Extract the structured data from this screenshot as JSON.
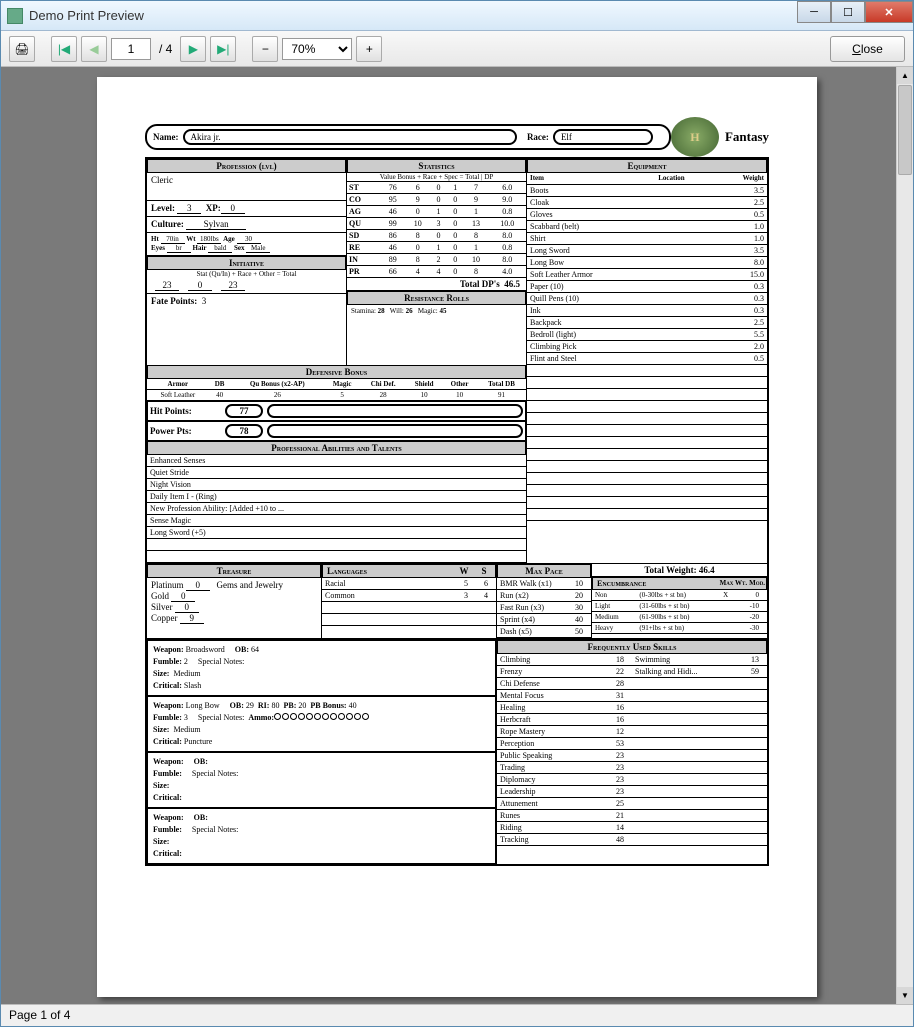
{
  "window": {
    "title": "Demo Print Preview"
  },
  "toolbar": {
    "page_current": "1",
    "page_total": "/ 4",
    "zoom": "70%",
    "close": "Close"
  },
  "status": "Page 1 of 4",
  "sheet": {
    "name_label": "Name:",
    "name": "Akira jr.",
    "race_label": "Race:",
    "race": "Elf",
    "fantasy": "Fantasy",
    "profession_label": "Profession (lvl)",
    "profession": "Cleric",
    "level_label": "Level:",
    "level": "3",
    "xp_label": "XP:",
    "xp": "0",
    "culture_label": "Culture:",
    "culture": "Sylvan",
    "ht_label": "Ht",
    "ht": "70in",
    "wt_label": "Wt",
    "wt": "180lbs",
    "age_label": "Age",
    "age": "30",
    "eyes_label": "Eyes",
    "eyes": "br",
    "hair_label": "Hair",
    "hair": "bald",
    "sex_label": "Sex",
    "sex": "Male",
    "initiative_label": "Initiative",
    "initiative_sub": "Stat (Qu/In) + Race + Other = Total",
    "init_stat": "23",
    "init_race": "0",
    "init_total": "23",
    "fate_label": "Fate Points:",
    "fate": "3",
    "stats_label": "Statistics",
    "stats_sub": "Value   Bonus + Race + Spec = Total | DP",
    "stats": [
      {
        "n": "ST",
        "v": "76",
        "b": "6",
        "r": "0",
        "s": "1",
        "t": "7",
        "dp": "6.0"
      },
      {
        "n": "CO",
        "v": "95",
        "b": "9",
        "r": "0",
        "s": "0",
        "t": "9",
        "dp": "9.0"
      },
      {
        "n": "AG",
        "v": "46",
        "b": "0",
        "r": "1",
        "s": "0",
        "t": "1",
        "dp": "0.8"
      },
      {
        "n": "QU",
        "v": "99",
        "b": "10",
        "r": "3",
        "s": "0",
        "t": "13",
        "dp": "10.0"
      },
      {
        "n": "SD",
        "v": "86",
        "b": "8",
        "r": "0",
        "s": "0",
        "t": "8",
        "dp": "8.0"
      },
      {
        "n": "RE",
        "v": "46",
        "b": "0",
        "r": "1",
        "s": "0",
        "t": "1",
        "dp": "0.8"
      },
      {
        "n": "IN",
        "v": "89",
        "b": "8",
        "r": "2",
        "s": "0",
        "t": "10",
        "dp": "8.0"
      },
      {
        "n": "PR",
        "v": "66",
        "b": "4",
        "r": "4",
        "s": "0",
        "t": "8",
        "dp": "4.0"
      }
    ],
    "total_dp_label": "Total DP's",
    "total_dp": "46.5",
    "rr_label": "Resistance Rolls",
    "rr_stamina_l": "Stamina:",
    "rr_stamina": "28",
    "rr_will_l": "Will:",
    "rr_will": "26",
    "rr_magic_l": "Magic:",
    "rr_magic": "45",
    "db_label": "Defensive Bonus",
    "db_hdr": [
      "Armor",
      "DB",
      "Qu Bonus (x2-AP)",
      "Magic",
      "Chi Def.",
      "Shield",
      "Other",
      "Total DB"
    ],
    "db_row": [
      "Soft Leather",
      "40",
      "26",
      "5",
      "28",
      "10",
      "10",
      "91"
    ],
    "hp_label": "Hit Points:",
    "hp": "77",
    "pp_label": "Power Pts:",
    "pp": "78",
    "abilities_label": "Professional Abilities and Talents",
    "abilities": [
      "Enhanced Senses",
      "Quiet Stride",
      "Night Vision",
      "Daily Item I - (Ring)",
      "New Profession Ability: [Added +10 to ...",
      "Sense Magic",
      "Long Sword (+5)"
    ],
    "equipment_label": "Equipment",
    "eq_hdr": [
      "Item",
      "Location",
      "Weight"
    ],
    "equipment": [
      {
        "n": "Boots",
        "w": "3.5"
      },
      {
        "n": "Cloak",
        "w": "2.5"
      },
      {
        "n": "Gloves",
        "w": "0.5"
      },
      {
        "n": "Scabbard (belt)",
        "w": "1.0"
      },
      {
        "n": "Shirt",
        "w": "1.0"
      },
      {
        "n": "Long Sword",
        "w": "3.5"
      },
      {
        "n": "Long Bow",
        "w": "8.0"
      },
      {
        "n": "Soft Leather Armor",
        "w": "15.0"
      },
      {
        "n": "Paper (10)",
        "w": "0.3"
      },
      {
        "n": "Quill Pens (10)",
        "w": "0.3"
      },
      {
        "n": "Ink",
        "w": "0.3"
      },
      {
        "n": "Backpack",
        "w": "2.5"
      },
      {
        "n": "Bedroll (light)",
        "w": "5.5"
      },
      {
        "n": "Climbing Pick",
        "w": "2.0"
      },
      {
        "n": "Flint and Steel",
        "w": "0.5"
      }
    ],
    "treasure_label": "Treasure",
    "treasure": [
      {
        "l": "Platinum",
        "v": "0"
      },
      {
        "l": "Gold",
        "v": "0"
      },
      {
        "l": "Silver",
        "v": "0"
      },
      {
        "l": "Copper",
        "v": "9"
      }
    ],
    "gems_label": "Gems and Jewelry",
    "lang_label": "Languages",
    "lang_hdr_w": "W",
    "lang_hdr_s": "S",
    "languages": [
      {
        "n": "Racial",
        "w": "5",
        "s": "6"
      },
      {
        "n": "Common",
        "w": "3",
        "s": "4"
      }
    ],
    "maxpace_label": "Max Pace",
    "paces": [
      {
        "n": "BMR Walk (x1)",
        "v": "10"
      },
      {
        "n": "Run (x2)",
        "v": "20"
      },
      {
        "n": "Fast Run (x3)",
        "v": "30"
      },
      {
        "n": "Sprint (x4)",
        "v": "40"
      },
      {
        "n": "Dash (x5)",
        "v": "50"
      }
    ],
    "totwt_label": "Total Weight:",
    "totwt": "46.4",
    "enc_label": "Encumbrance",
    "enc_hdr": [
      "Max Wt.",
      "Mod."
    ],
    "enc": [
      {
        "n": "Non",
        "d": "(0-30lbs + st bn)",
        "x": "X",
        "m": "0"
      },
      {
        "n": "Light",
        "d": "(31-60lbs + st bn)",
        "x": "",
        "m": "-10"
      },
      {
        "n": "Medium",
        "d": "(61-90lbs + st bn)",
        "x": "",
        "m": "-20"
      },
      {
        "n": "Heavy",
        "d": "(91+lbs + st bn)",
        "x": "",
        "m": "-30"
      }
    ],
    "fus_label": "Frequently Used Skills",
    "skills_l": [
      {
        "n": "Climbing",
        "v": "18"
      },
      {
        "n": "Frenzy",
        "v": "22"
      },
      {
        "n": "Chi Defense",
        "v": "28"
      },
      {
        "n": "Mental Focus",
        "v": "31"
      },
      {
        "n": "Healing",
        "v": "16"
      },
      {
        "n": "Herbcraft",
        "v": "16"
      },
      {
        "n": "Rope Mastery",
        "v": "12"
      },
      {
        "n": "Perception",
        "v": "53"
      },
      {
        "n": "Public Speaking",
        "v": "23"
      },
      {
        "n": "Trading",
        "v": "23"
      },
      {
        "n": "Diplomacy",
        "v": "23"
      },
      {
        "n": "Leadership",
        "v": "23"
      },
      {
        "n": "Attunement",
        "v": "25"
      },
      {
        "n": "Runes",
        "v": "21"
      },
      {
        "n": "Riding",
        "v": "14"
      },
      {
        "n": "Tracking",
        "v": "48"
      }
    ],
    "skills_r": [
      {
        "n": "Swimming",
        "v": "13"
      },
      {
        "n": "Stalking and Hidi...",
        "v": "59"
      }
    ],
    "weapons": [
      {
        "name": "Broadsword",
        "ob": "64",
        "fumble": "2",
        "size": "Medium",
        "crit": "Slash",
        "notes": "Special Notes:",
        "ammo": ""
      },
      {
        "name": "Long Bow",
        "ob": "29",
        "ri": "80",
        "pb": "20",
        "pbbonus": "40",
        "fumble": "3",
        "size": "Medium",
        "crit": "Puncture",
        "notes": "Special Notes:",
        "ammo": "ammo"
      },
      {
        "name": "",
        "ob": "",
        "fumble": "",
        "size": "",
        "crit": "",
        "notes": "Special Notes:",
        "ammo": ""
      },
      {
        "name": "",
        "ob": "",
        "fumble": "",
        "size": "",
        "crit": "",
        "notes": "Special Notes:",
        "ammo": ""
      }
    ],
    "wlbl": {
      "weapon": "Weapon:",
      "ob": "OB:",
      "ri": "RI:",
      "pb": "PB:",
      "pbbonus": "PB Bonus:",
      "fumble": "Fumble:",
      "size": "Size:",
      "crit": "Critical:",
      "ammo": "Ammo:"
    }
  }
}
